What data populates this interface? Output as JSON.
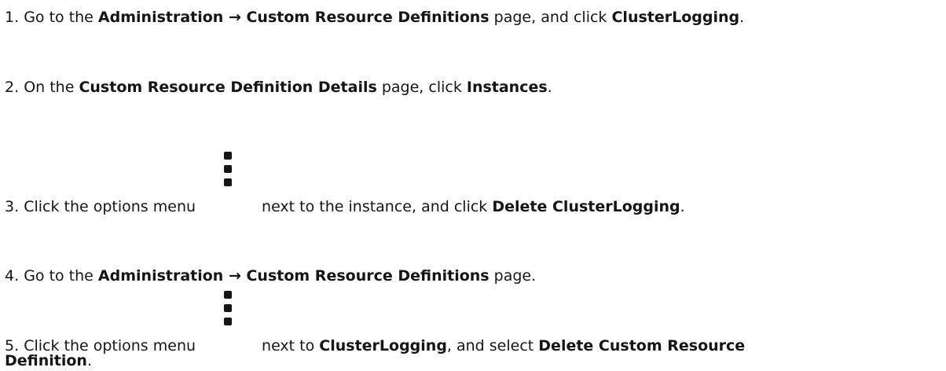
{
  "steps": [
    {
      "number": "1.",
      "t1": "Go to the ",
      "b1": "Administration → Custom Resource Definitions",
      "t2": " page, and click ",
      "b2": "ClusterLogging",
      "t3": "."
    },
    {
      "number": "2.",
      "t1": "On the ",
      "b1": "Custom Resource Definition Details",
      "t2": " page, click ",
      "b2": "Instances",
      "t3": "."
    },
    {
      "number": "3.",
      "t1": "Click the options menu",
      "icon": "kebab-options-icon",
      "t2": "next to the instance, and click ",
      "b1": "Delete ClusterLogging",
      "t3": "."
    },
    {
      "number": "4.",
      "t1": "Go to the ",
      "b1": "Administration → Custom Resource Definitions",
      "t2": " page."
    },
    {
      "number": "5.",
      "t1": "Click the options menu",
      "icon": "kebab-options-icon",
      "t2": "next to ",
      "b1": "ClusterLogging",
      "t3": ", and select ",
      "b2": "Delete Custom Resource",
      "b3": "Definition",
      "t4": "."
    }
  ]
}
